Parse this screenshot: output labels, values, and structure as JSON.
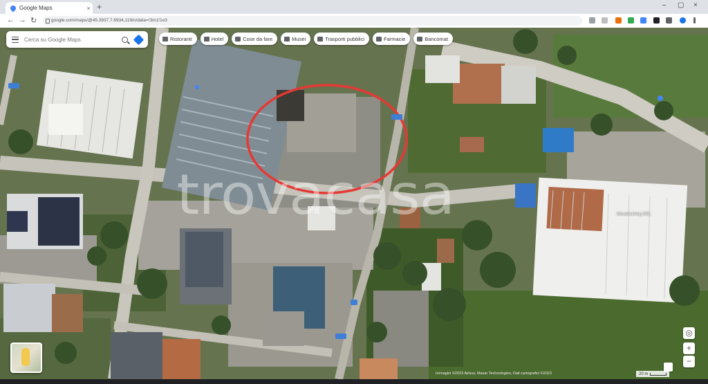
{
  "browser": {
    "tab_title": "Google Maps",
    "tab_close": "×",
    "new_tab": "+",
    "window_controls": [
      "–",
      "▢",
      "×"
    ],
    "url": "google.com/maps/@45.3937,7.6934,119m/data=!3m1!1e3",
    "nav": [
      "←",
      "→",
      "↻"
    ]
  },
  "maps": {
    "search_placeholder": "Cerca su Google Maps",
    "chips": [
      {
        "label": "Ristoranti",
        "icon": "restaurant-icon"
      },
      {
        "label": "Hotel",
        "icon": "hotel-icon"
      },
      {
        "label": "Cose da fare",
        "icon": "attractions-icon"
      },
      {
        "label": "Musei",
        "icon": "museum-icon"
      },
      {
        "label": "Trasporti pubblici",
        "icon": "transit-icon"
      },
      {
        "label": "Farmacie",
        "icon": "pharmacy-icon"
      },
      {
        "label": "Bancomat",
        "icon": "atm-icon"
      }
    ],
    "zoom_in": "+",
    "zoom_out": "−",
    "place_label": "Woodworking SRL",
    "credits": "Immagini ©2023 Airbus, Maxar Technologies, Dati cartografici ©2023",
    "scale_label": "20 m"
  },
  "watermark": "trovacasa",
  "highlight_color": "#e53935"
}
